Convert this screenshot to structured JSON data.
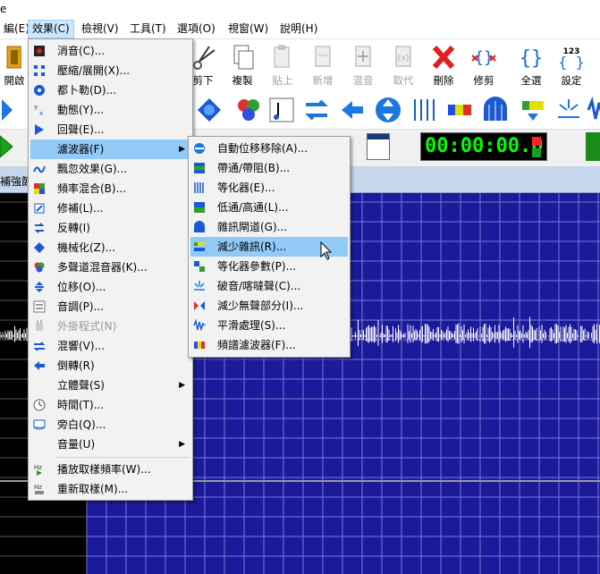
{
  "titlebar": {
    "text": "e"
  },
  "menubar": {
    "items": [
      {
        "label": "編(E)"
      },
      {
        "label": "效果(C)"
      },
      {
        "label": "檢視(V)"
      },
      {
        "label": "工具(T)"
      },
      {
        "label": "選項(O)"
      },
      {
        "label": "視窗(W)"
      },
      {
        "label": "說明(H)"
      }
    ]
  },
  "toolbar": {
    "open_label": "開啟",
    "cut_label": "剪下",
    "copy_label": "複製",
    "paste_label": "貼上",
    "new_label": "新增",
    "mix_label": "混音",
    "replace_label": "取代",
    "delete_label": "刪除",
    "trim_label": "修剪",
    "selectall_label": "全選",
    "settings_label": "設定",
    "settings_icon_text": "123"
  },
  "timecode": {
    "display": "00:00:00.0"
  },
  "track": {
    "label": "補強節"
  },
  "effects_menu": {
    "items": [
      {
        "label": "消音(C)..."
      },
      {
        "label": "壓縮/展開(X)..."
      },
      {
        "label": "都卜勒(D)..."
      },
      {
        "label": "動態(Y)..."
      },
      {
        "label": "回聲(E)..."
      },
      {
        "label": "濾波器(F)"
      },
      {
        "label": "飄忽效果(G)..."
      },
      {
        "label": "頻率混合(B)..."
      },
      {
        "label": "修補(L)..."
      },
      {
        "label": "反轉(I)"
      },
      {
        "label": "機械化(Z)..."
      },
      {
        "label": "多聲道混音器(K)..."
      },
      {
        "label": "位移(O)..."
      },
      {
        "label": "音調(P)..."
      },
      {
        "label": "外掛程式(N)"
      },
      {
        "label": "混響(V)..."
      },
      {
        "label": "倒轉(R)"
      },
      {
        "label": "立體聲(S)"
      },
      {
        "label": "時間(T)..."
      },
      {
        "label": "旁白(Q)..."
      },
      {
        "label": "音量(U)"
      },
      {
        "label": "播放取樣頻率(W)..."
      },
      {
        "label": "重新取樣(M)..."
      }
    ],
    "hz_icon": "Hz"
  },
  "filter_menu": {
    "items": [
      {
        "label": "自動位移移除(A)..."
      },
      {
        "label": "帶通/帶阻(B)..."
      },
      {
        "label": "等化器(E)..."
      },
      {
        "label": "低通/高通(L)..."
      },
      {
        "label": "雜訊閘道(G)..."
      },
      {
        "label": "減少雜訊(R)..."
      },
      {
        "label": "等化器參數(P)..."
      },
      {
        "label": "破音/喀噠聲(C)..."
      },
      {
        "label": "減少無聲部分(I)..."
      },
      {
        "label": "平滑處理(S)..."
      },
      {
        "label": "頻譜濾波器(F)..."
      }
    ]
  }
}
